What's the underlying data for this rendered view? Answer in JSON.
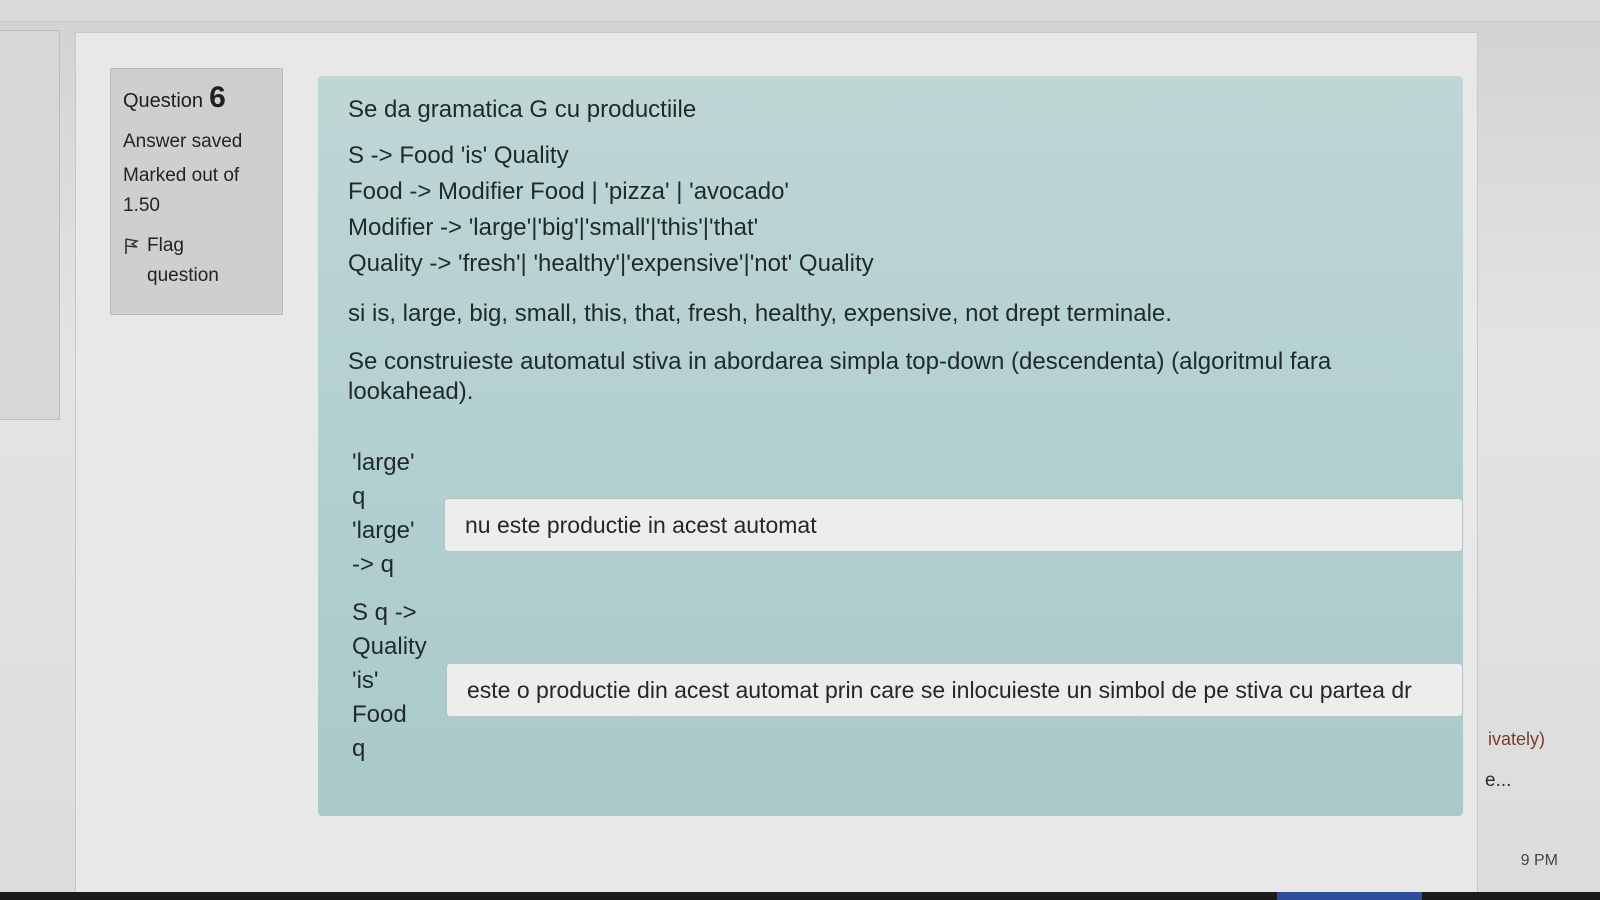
{
  "sidebar": {
    "question_label": "Question",
    "question_number": "6",
    "status": "Answer saved",
    "marked_out_of": "Marked out of",
    "points": "1.50",
    "flag_label": "Flag",
    "flag_label2": "question"
  },
  "question": {
    "intro": "Se da gramatica G cu productiile",
    "productions": [
      "S -> Food 'is' Quality",
      "Food -> Modifier Food | 'pizza' | 'avocado'",
      "Modifier -> 'large'|'big'|'small'|'this'|'that'",
      "Quality -> 'fresh'| 'healthy'|'expensive'|'not' Quality"
    ],
    "terminals": "si is, large, big, small, this, that, fresh, healthy, expensive, not drept terminale.",
    "instruction_line1": "Se construieste automatul stiva in abordarea simpla top-down (descendenta) (algoritmul fara",
    "instruction_line2": "lookahead)."
  },
  "matches": [
    {
      "prompt_lines": [
        "'large'",
        "q",
        "'large'",
        "-> q"
      ],
      "answer": "nu este productie in acest automat"
    },
    {
      "prompt_lines": [
        "S q ->",
        "Quality",
        "'is'",
        "Food",
        "q"
      ],
      "answer": "este o productie din acest automat prin care se inlocuieste un simbol de pe stiva cu partea dr"
    }
  ],
  "right_panel": {
    "fragment1": "ivately)",
    "fragment2": "e..."
  },
  "taskbar": {
    "clock": "9 PM"
  }
}
